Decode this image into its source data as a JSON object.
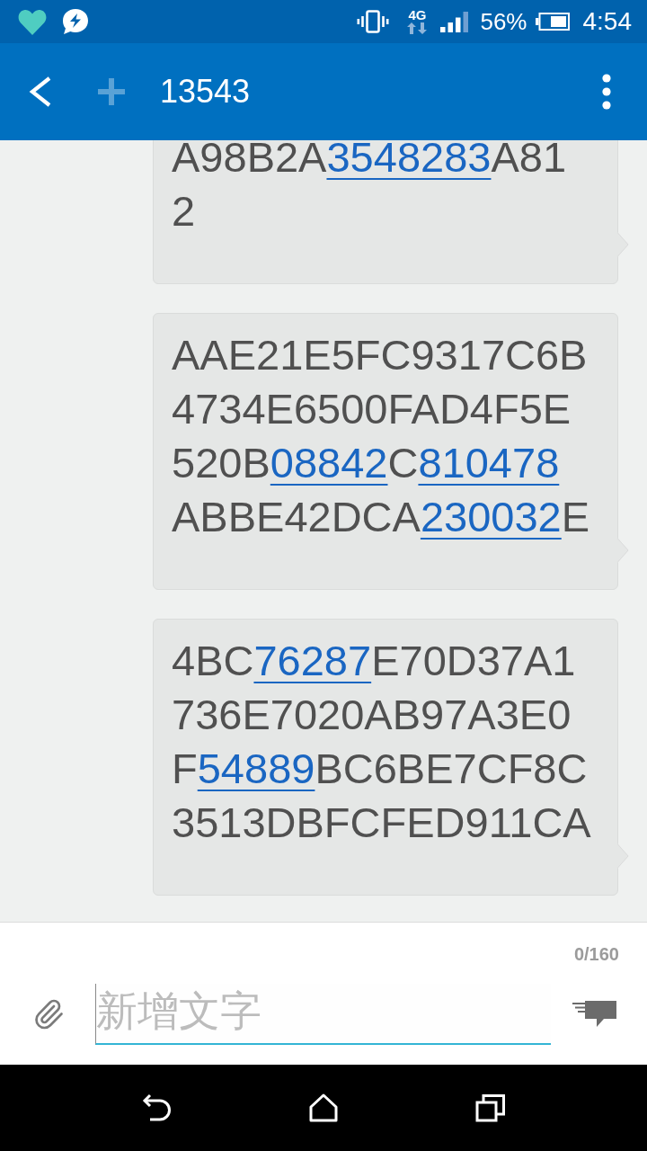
{
  "status_bar": {
    "network_type": "4G",
    "battery": "56%",
    "time": "4:54"
  },
  "app_bar": {
    "title": "13543",
    "add_button": {
      "disabled": true
    }
  },
  "messages": [
    {
      "lines": [
        [
          {
            "text": "A98B2A",
            "kind": "text"
          },
          {
            "text": "3548283",
            "kind": "link"
          },
          {
            "text": "A81",
            "kind": "text"
          }
        ],
        [
          {
            "text": "2",
            "kind": "text"
          }
        ]
      ]
    },
    {
      "lines": [
        [
          {
            "text": "AAE21E5FC9317C6B",
            "kind": "text"
          }
        ],
        [
          {
            "text": "4734E6500FAD4F5E",
            "kind": "text"
          }
        ],
        [
          {
            "text": "520B",
            "kind": "text"
          },
          {
            "text": "08842",
            "kind": "link"
          },
          {
            "text": "C",
            "kind": "text"
          },
          {
            "text": "810478",
            "kind": "link"
          }
        ],
        [
          {
            "text": "ABBE42DCA",
            "kind": "text"
          },
          {
            "text": "230032",
            "kind": "link"
          },
          {
            "text": "E",
            "kind": "text"
          }
        ]
      ]
    },
    {
      "lines": [
        [
          {
            "text": "4BC",
            "kind": "text"
          },
          {
            "text": "76287",
            "kind": "link"
          },
          {
            "text": "E70D37A1",
            "kind": "text"
          }
        ],
        [
          {
            "text": "736E7020AB97A3E0",
            "kind": "text"
          }
        ],
        [
          {
            "text": "F",
            "kind": "text"
          },
          {
            "text": "54889",
            "kind": "link"
          },
          {
            "text": "BC6BE7CF8C",
            "kind": "text"
          }
        ],
        [
          {
            "text": "3513DBFCFED911CA",
            "kind": "text"
          }
        ]
      ]
    }
  ],
  "composer": {
    "counter": "0/160",
    "placeholder": "新增文字"
  }
}
